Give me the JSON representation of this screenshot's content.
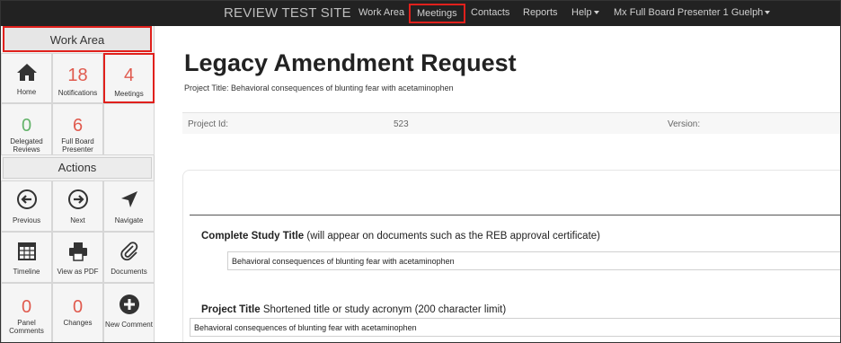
{
  "navbar": {
    "brand": "REVIEW TEST SITE",
    "items": [
      {
        "label": "Work Area"
      },
      {
        "label": "Meetings"
      },
      {
        "label": "Contacts"
      },
      {
        "label": "Reports"
      },
      {
        "label": "Help"
      },
      {
        "label": "Mx Full Board Presenter 1 Guelph"
      }
    ]
  },
  "sidebar": {
    "work_area_title": "Work Area",
    "actions_title": "Actions",
    "work_tiles": [
      {
        "label": "Home",
        "icon": "home-icon"
      },
      {
        "label": "Notifications",
        "count": "18"
      },
      {
        "label": "Meetings",
        "count": "4"
      },
      {
        "label": "Delegated Reviews",
        "count": "0"
      },
      {
        "label": "Full Board Presenter",
        "count": "6"
      }
    ],
    "action_tiles": [
      {
        "label": "Previous",
        "icon": "arrow-left-circle-icon"
      },
      {
        "label": "Next",
        "icon": "arrow-right-circle-icon"
      },
      {
        "label": "Navigate",
        "icon": "navigate-arrow-icon"
      },
      {
        "label": "Timeline",
        "icon": "calendar-icon"
      },
      {
        "label": "View as PDF",
        "icon": "printer-icon"
      },
      {
        "label": "Documents",
        "icon": "paperclip-icon"
      },
      {
        "label": "Panel Comments",
        "count": "0"
      },
      {
        "label": "Changes",
        "count": "0"
      },
      {
        "label": "New Comment",
        "icon": "plus-circle-icon"
      }
    ],
    "colors": {
      "count_red": "#e05a4e",
      "count_green": "#63b36a",
      "highlight": "#e0201c"
    }
  },
  "main": {
    "title": "Legacy Amendment Request",
    "project_title_line": "Project Title: Behavioral consequences of blunting fear with acetaminophen",
    "info": {
      "project_id_label": "Project Id:",
      "project_id_value": "523",
      "version_label": "Version:"
    },
    "fields": [
      {
        "label_bold": "Complete Study Title",
        "label_rest": " (will appear on documents such as the REB approval certificate)",
        "value": "Behavioral consequences of blunting fear with acetaminophen"
      },
      {
        "label_bold": "Project Title",
        "label_rest": " Shortened title or study acronym (200 character limit)",
        "value": "Behavioral consequences of blunting fear with acetaminophen"
      }
    ]
  }
}
